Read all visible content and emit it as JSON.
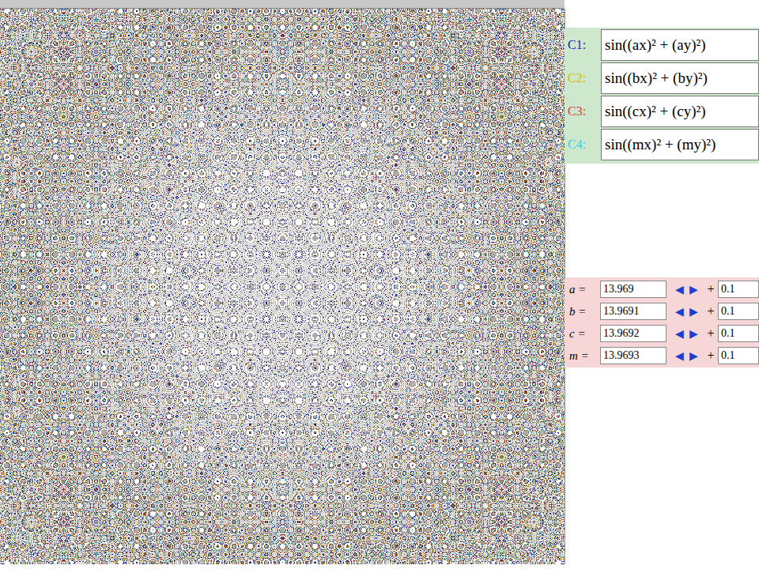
{
  "curves": [
    {
      "label": "C1:",
      "formula": "sin((ax)² + (ay)²)",
      "color": "#1f1fbf"
    },
    {
      "label": "C2:",
      "formula": "sin((bx)² + (by)²)",
      "color": "#d9bc00"
    },
    {
      "label": "C3:",
      "formula": "sin((cx)² + (cy)²)",
      "color": "#e03c3c"
    },
    {
      "label": "C4:",
      "formula": "sin((mx)² + (my)²)",
      "color": "#3fd0e0"
    }
  ],
  "parameters": [
    {
      "name": "a =",
      "value": "13.969",
      "decrement": "◀",
      "increment": "▶",
      "plus": "+",
      "step": "0.1"
    },
    {
      "name": "b =",
      "value": "13.9691",
      "decrement": "◀",
      "increment": "▶",
      "plus": "+",
      "step": "0.1"
    },
    {
      "name": "c =",
      "value": "13.9692",
      "decrement": "◀",
      "increment": "▶",
      "plus": "+",
      "step": "0.1"
    },
    {
      "name": "m =",
      "value": "13.9693",
      "decrement": "◀",
      "increment": "▶",
      "plus": "+",
      "step": "0.1"
    }
  ]
}
